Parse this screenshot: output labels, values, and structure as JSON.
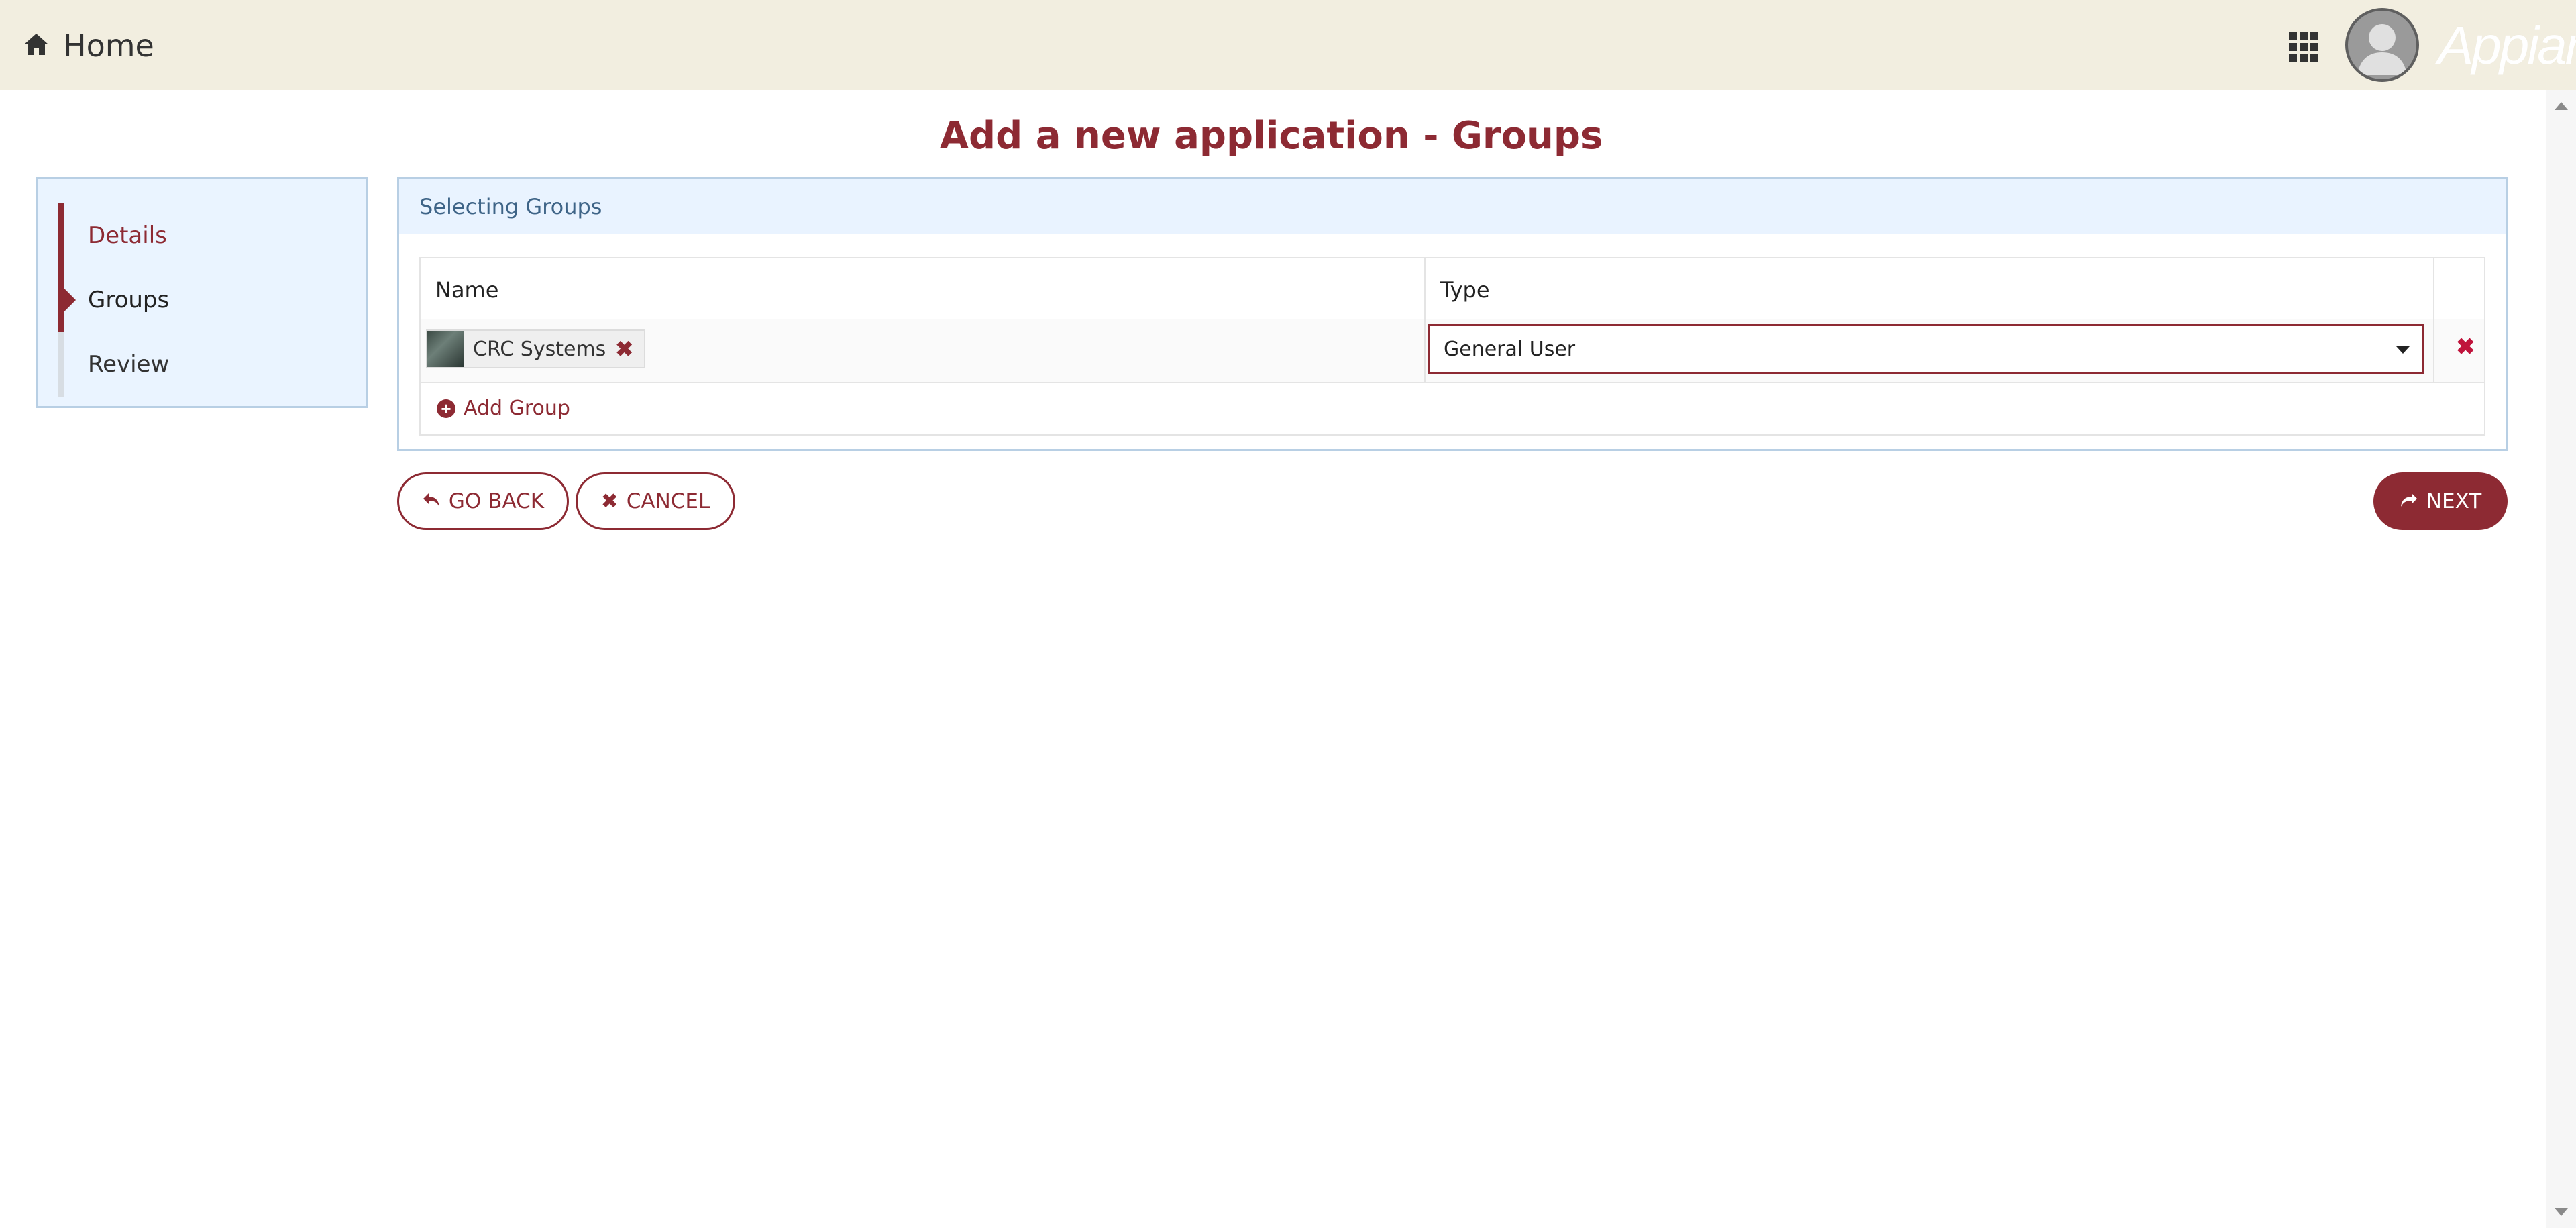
{
  "header": {
    "home_label": "Home",
    "brand": "Appian",
    "icons": {
      "home": "home-icon",
      "apps": "grid-apps-icon",
      "avatar": "user-avatar"
    }
  },
  "page": {
    "title": "Add a new application - Groups"
  },
  "steps": [
    {
      "label": "Details",
      "state": "completed"
    },
    {
      "label": "Groups",
      "state": "current"
    },
    {
      "label": "Review",
      "state": "pending"
    }
  ],
  "panel": {
    "title": "Selecting Groups",
    "table": {
      "columns": [
        "Name",
        "Type"
      ],
      "rows": [
        {
          "group": "CRC Systems",
          "type": "General User"
        }
      ]
    },
    "add_link": "Add Group"
  },
  "buttons": {
    "back": "GO BACK",
    "cancel": "CANCEL",
    "next": "NEXT"
  },
  "colors": {
    "accent": "#8d2a33",
    "header_bg": "#f2eee0",
    "panel_head_bg": "#e9f3ff",
    "delete_red": "#c0143c"
  }
}
